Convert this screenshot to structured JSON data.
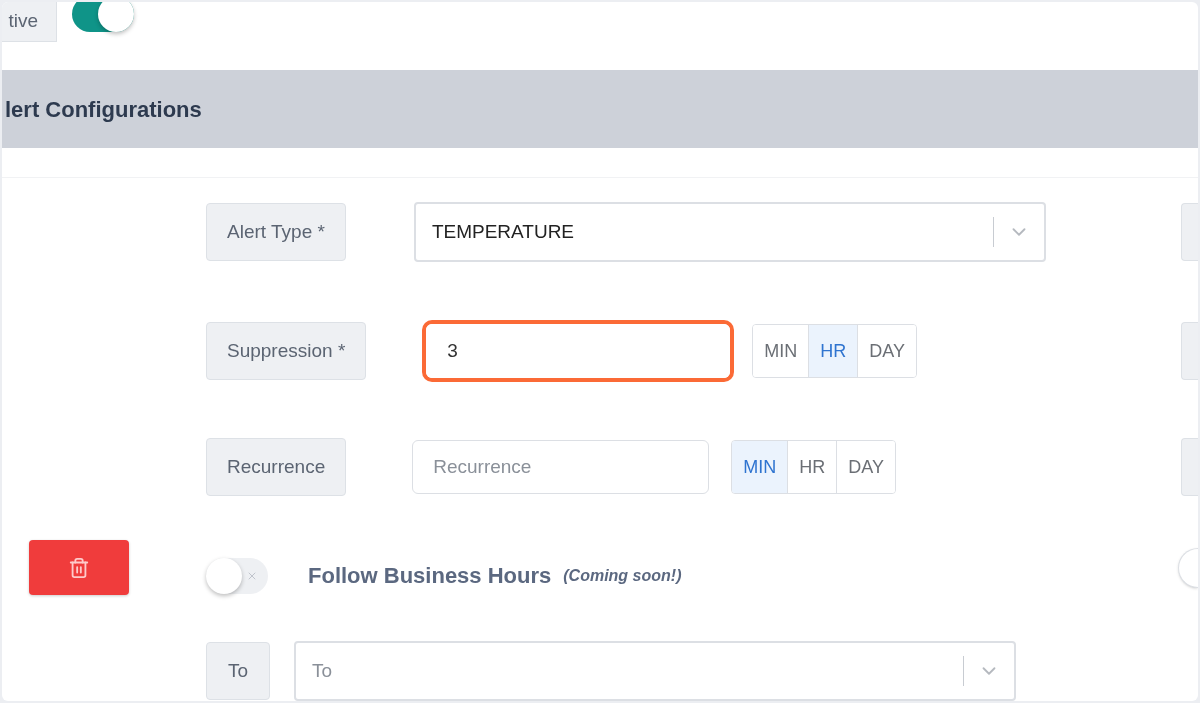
{
  "status": {
    "label": "tive",
    "on": true
  },
  "section": {
    "title": "lert Configurations"
  },
  "fields": [
    {
      "kind": "select",
      "label": "Alert Type *",
      "value": "TEMPERATURE",
      "highlighted": false
    },
    {
      "kind": "number",
      "label": "Suppression *",
      "value": "3",
      "highlighted": true,
      "units": [
        {
          "label": "MIN",
          "selected": false
        },
        {
          "label": "HR",
          "selected": true
        },
        {
          "label": "DAY",
          "selected": false
        }
      ]
    },
    {
      "kind": "number",
      "label": "Recurrence",
      "placeholder": "Recurrence",
      "highlighted": false,
      "units": [
        {
          "label": "MIN",
          "selected": true
        },
        {
          "label": "HR",
          "selected": false
        },
        {
          "label": "DAY",
          "selected": false
        }
      ]
    }
  ],
  "business_hours": {
    "label": "Follow Business Hours",
    "note": "(Coming soon!)",
    "on": false
  },
  "recipients": {
    "label": "To",
    "placeholder": "To"
  }
}
